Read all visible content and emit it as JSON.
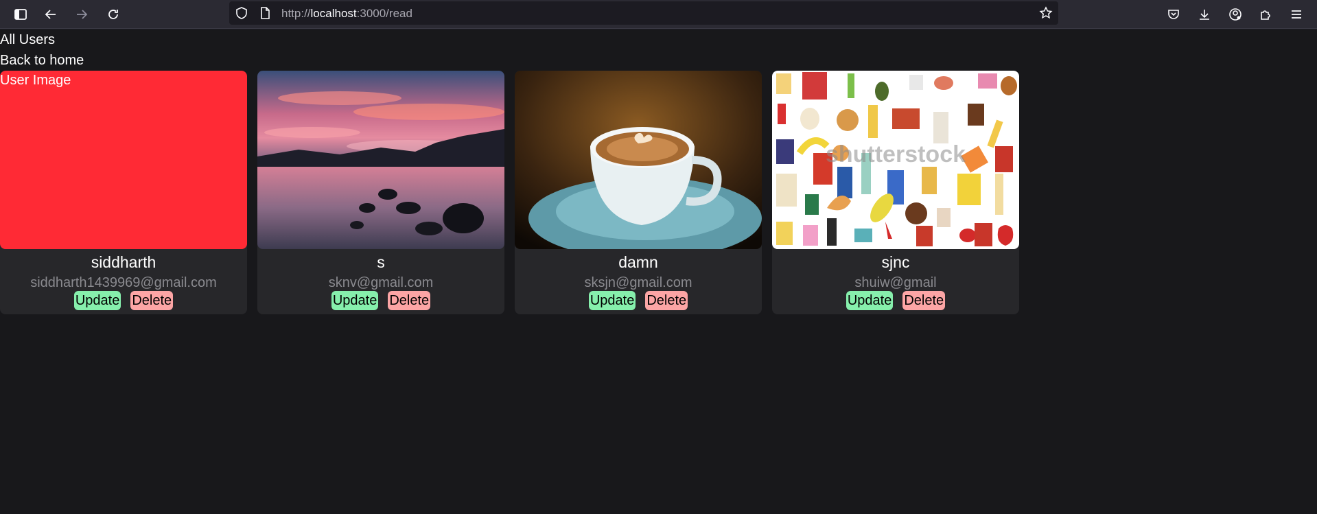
{
  "browser": {
    "url_prefix": "http://",
    "url_host": "localhost",
    "url_path": ":3000/read"
  },
  "page": {
    "heading": "All Users",
    "back_link": "Back to home"
  },
  "users": [
    {
      "name": "siddharth",
      "email": "siddharth1439969@gmail.com",
      "image_alt": "User Image",
      "image": "broken-image-red",
      "update_label": "Update",
      "delete_label": "Delete"
    },
    {
      "name": "s",
      "email": "sknv@gmail.com",
      "image": "lake-sunset-photo",
      "update_label": "Update",
      "delete_label": "Delete"
    },
    {
      "name": "damn",
      "email": "sksjn@gmail.com",
      "image": "coffee-cup-photo",
      "update_label": "Update",
      "delete_label": "Delete"
    },
    {
      "name": "sjnc",
      "email": "shuiw@gmail",
      "image": "groceries-illustration",
      "watermark": "shutterstock",
      "update_label": "Update",
      "delete_label": "Delete"
    }
  ],
  "colors": {
    "update_button": "#86efac",
    "delete_button": "#fca5a5",
    "card_bg": "#27272a",
    "page_bg": "#18181b",
    "broken_image_bg": "#ff2a35"
  }
}
